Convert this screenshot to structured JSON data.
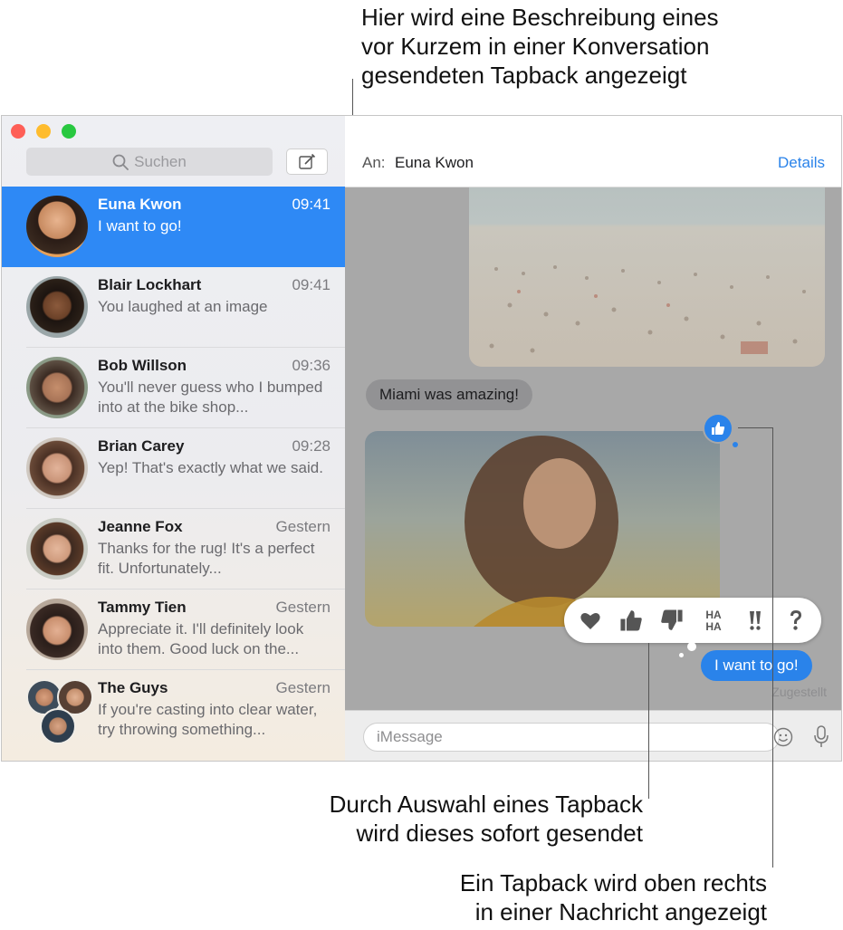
{
  "callouts": {
    "top": [
      "Hier wird eine Beschreibung eines",
      "vor Kurzem in einer Konversation",
      "gesendeten Tapback angezeigt"
    ],
    "middle": [
      "Durch Auswahl eines Tapback",
      "wird dieses sofort gesendet"
    ],
    "bottom": [
      "Ein Tapback wird oben rechts",
      "in einer Nachricht angezeigt"
    ]
  },
  "sidebar": {
    "search_placeholder": "Suchen",
    "conversations": [
      {
        "name": "Euna Kwon",
        "time": "09:41",
        "preview": "I want to go!",
        "selected": true
      },
      {
        "name": "Blair Lockhart",
        "time": "09:41",
        "preview": "You laughed at an image"
      },
      {
        "name": "Bob Willson",
        "time": "09:36",
        "preview": "You'll never guess who I bumped into at the bike shop..."
      },
      {
        "name": "Brian Carey",
        "time": "09:28",
        "preview": "Yep! That's exactly what we said."
      },
      {
        "name": "Jeanne Fox",
        "time": "Gestern",
        "preview": "Thanks for the rug! It's a perfect fit. Unfortunately..."
      },
      {
        "name": "Tammy Tien",
        "time": "Gestern",
        "preview": "Appreciate it. I'll definitely look into them. Good luck on the..."
      },
      {
        "name": "The Guys",
        "time": "Gestern",
        "preview": "If you're casting into clear water, try throwing something..."
      }
    ]
  },
  "chat": {
    "to_label": "An:",
    "recipient": "Euna Kwon",
    "details_label": "Details",
    "messages": {
      "incoming_text": "Miami was amazing!",
      "outgoing_text": "I want to go!",
      "status": "Zugestellt"
    },
    "tapback_options": [
      "heart-icon",
      "thumbs-up-icon",
      "thumbs-down-icon",
      "haha-icon",
      "exclamation-icon",
      "question-icon"
    ],
    "input_placeholder": "iMessage"
  },
  "colors": {
    "accent": "#2a83ea",
    "selected_row": "#2e89f5",
    "traffic_red": "#fe5f57",
    "traffic_yellow": "#febc2e",
    "traffic_green": "#28c840"
  }
}
